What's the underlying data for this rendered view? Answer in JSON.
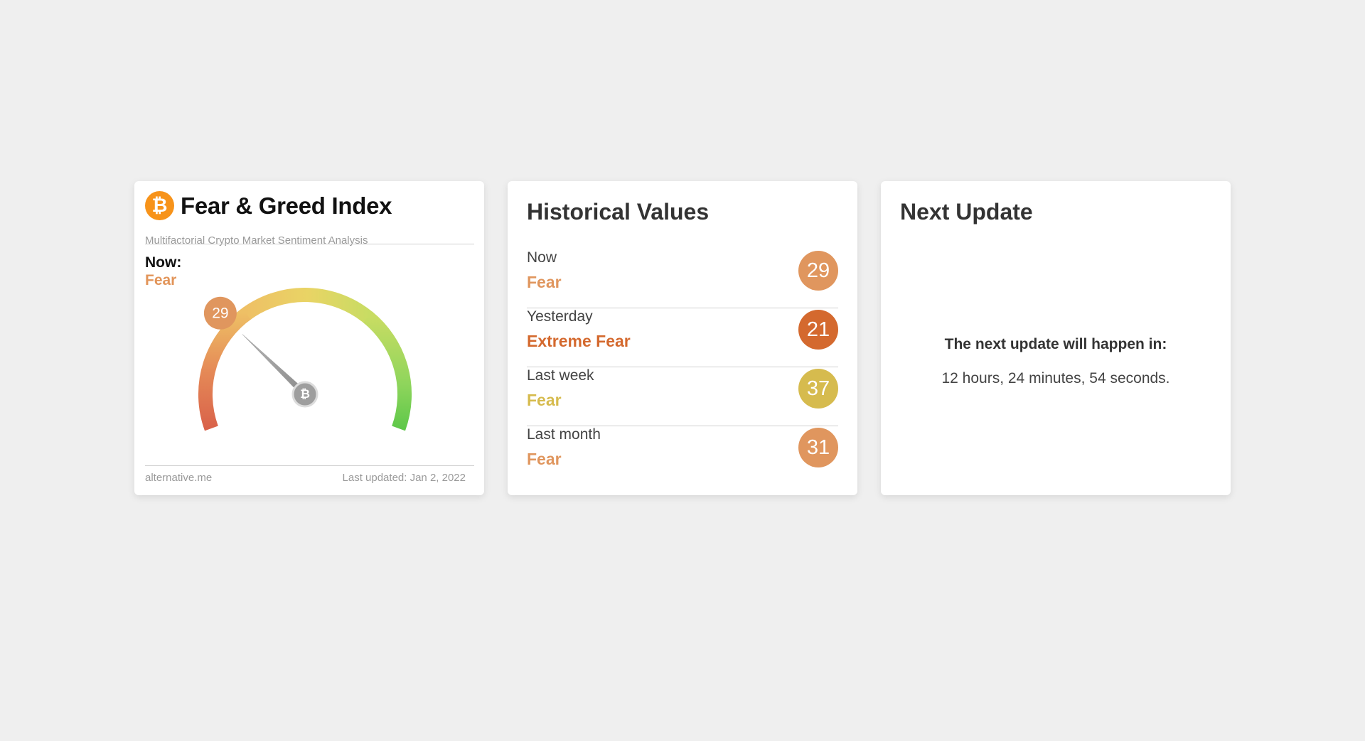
{
  "fear_greed": {
    "logo_glyph": "₿",
    "title": "Fear & Greed Index",
    "subtitle": "Multifactorial Crypto Market Sentiment Analysis",
    "now_label": "Now:",
    "now_classification": "Fear",
    "gauge_value": 29,
    "gauge_value_text": "29",
    "needle_glyph": "₿",
    "source": "alternative.me",
    "last_updated": "Last updated: Jan 2, 2022"
  },
  "historical": {
    "title": "Historical Values",
    "rows": [
      {
        "period": "Now",
        "classification": "Fear",
        "value": "29",
        "color": "#e0965e"
      },
      {
        "period": "Yesterday",
        "classification": "Extreme Fear",
        "value": "21",
        "color": "#d4692e"
      },
      {
        "period": "Last week",
        "classification": "Fear",
        "value": "37",
        "color": "#d6bb4e"
      },
      {
        "period": "Last month",
        "classification": "Fear",
        "value": "31",
        "color": "#e0965e"
      }
    ]
  },
  "next_update": {
    "title": "Next Update",
    "label": "The next update will happen in:",
    "countdown": "12 hours, 24 minutes, 54 seconds."
  },
  "colors": {
    "background": "#efefef",
    "fear": "#e0965e",
    "extreme_fear": "#d4692e",
    "fear_yellow": "#d6bb4e",
    "bitcoin_orange": "#f7931a"
  }
}
